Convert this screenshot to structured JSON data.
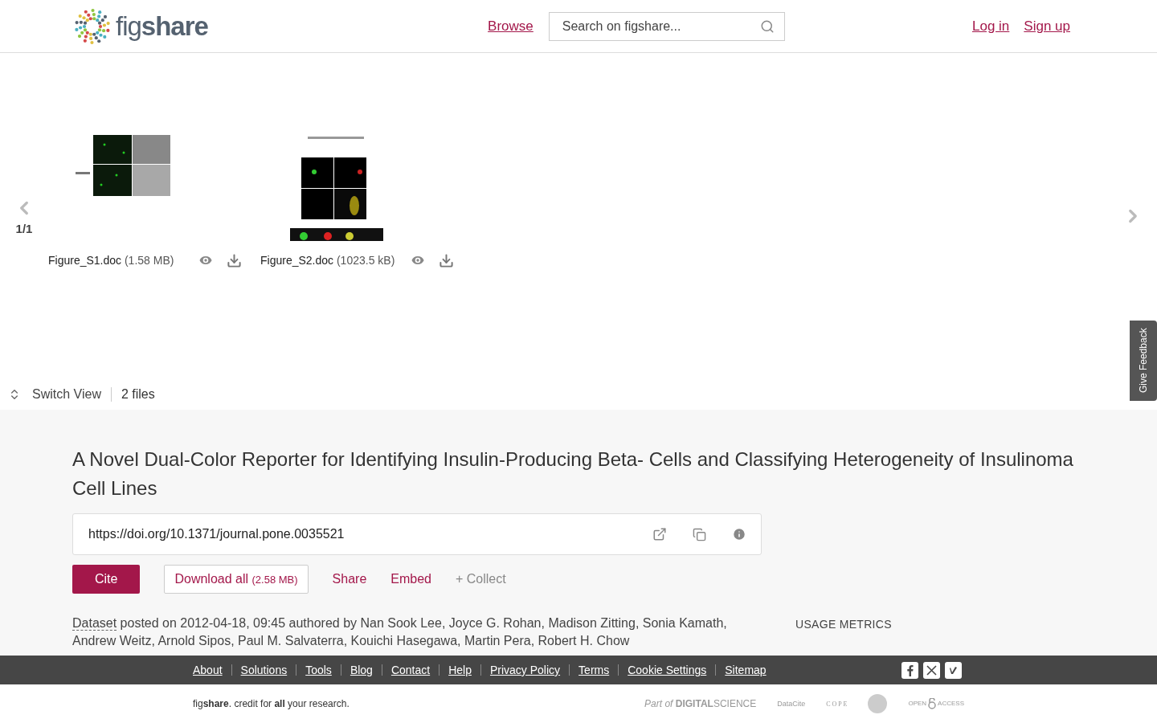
{
  "header": {
    "logo": "fig**share**",
    "nav_link": "Browse",
    "search": {
      "placeholder": "Search on figshare..."
    },
    "auth_links": [
      "Log in",
      "Sign up"
    ]
  },
  "gallery": {
    "counter": "1/1",
    "files": [
      {
        "name": "Figure_S1.doc",
        "size": "(1.58 MB)"
      },
      {
        "name": "Figure_S2.doc",
        "size": "(1023.5 kB)"
      }
    ],
    "switch_view": "Switch View",
    "file_count": "2 files"
  },
  "feedback_tab": "Give Feedback",
  "item": {
    "title": "A Novel Dual-Color Reporter for Identifying Insulin-Producing Beta- Cells and Classifying Heterogeneity of Insulinoma Cell Lines",
    "doi": "https://doi.org/10.1371/journal.pone.0035521",
    "actions": [
      {
        "kind": "primary",
        "label": "Cite"
      },
      {
        "kind": "outline",
        "label": "Download all",
        "detail": "(2.58 MB)"
      },
      {
        "kind": "link",
        "label": "Share"
      },
      {
        "kind": "link",
        "label": "Embed"
      },
      {
        "kind": "muted",
        "label": "+ Collect"
      }
    ],
    "type_link": "Dataset",
    "posted": " posted on 2012-04-18, 09:45 authored by Nan Sook Lee, Joyce G. Rohan, Madison Zitting, Sonia Kamath, Andrew Weitz, Arnold Sipos, Paul M. Salvaterra, Kouichi Hasegawa, Martin Pera, Robert H. Chow",
    "usage_heading": "USAGE METRICS"
  },
  "footer": {
    "links": [
      "About",
      "Solutions",
      "Tools",
      "Blog",
      "Contact",
      "Help",
      "Privacy Policy",
      "Terms",
      "Cookie Settings",
      "Sitemap"
    ],
    "tagline": "fig**share**. credit for **all** your research.",
    "partners": [
      {
        "kind": "ds",
        "label": "*Part of* **DIGITAL**SCIENCE"
      },
      {
        "kind": "datacite",
        "label": "DataCite"
      },
      {
        "kind": "cope",
        "label": "C O P E"
      },
      {
        "kind": "seal"
      },
      {
        "kind": "oa",
        "label": "OPEN",
        "label2": "ACCESS"
      }
    ]
  }
}
